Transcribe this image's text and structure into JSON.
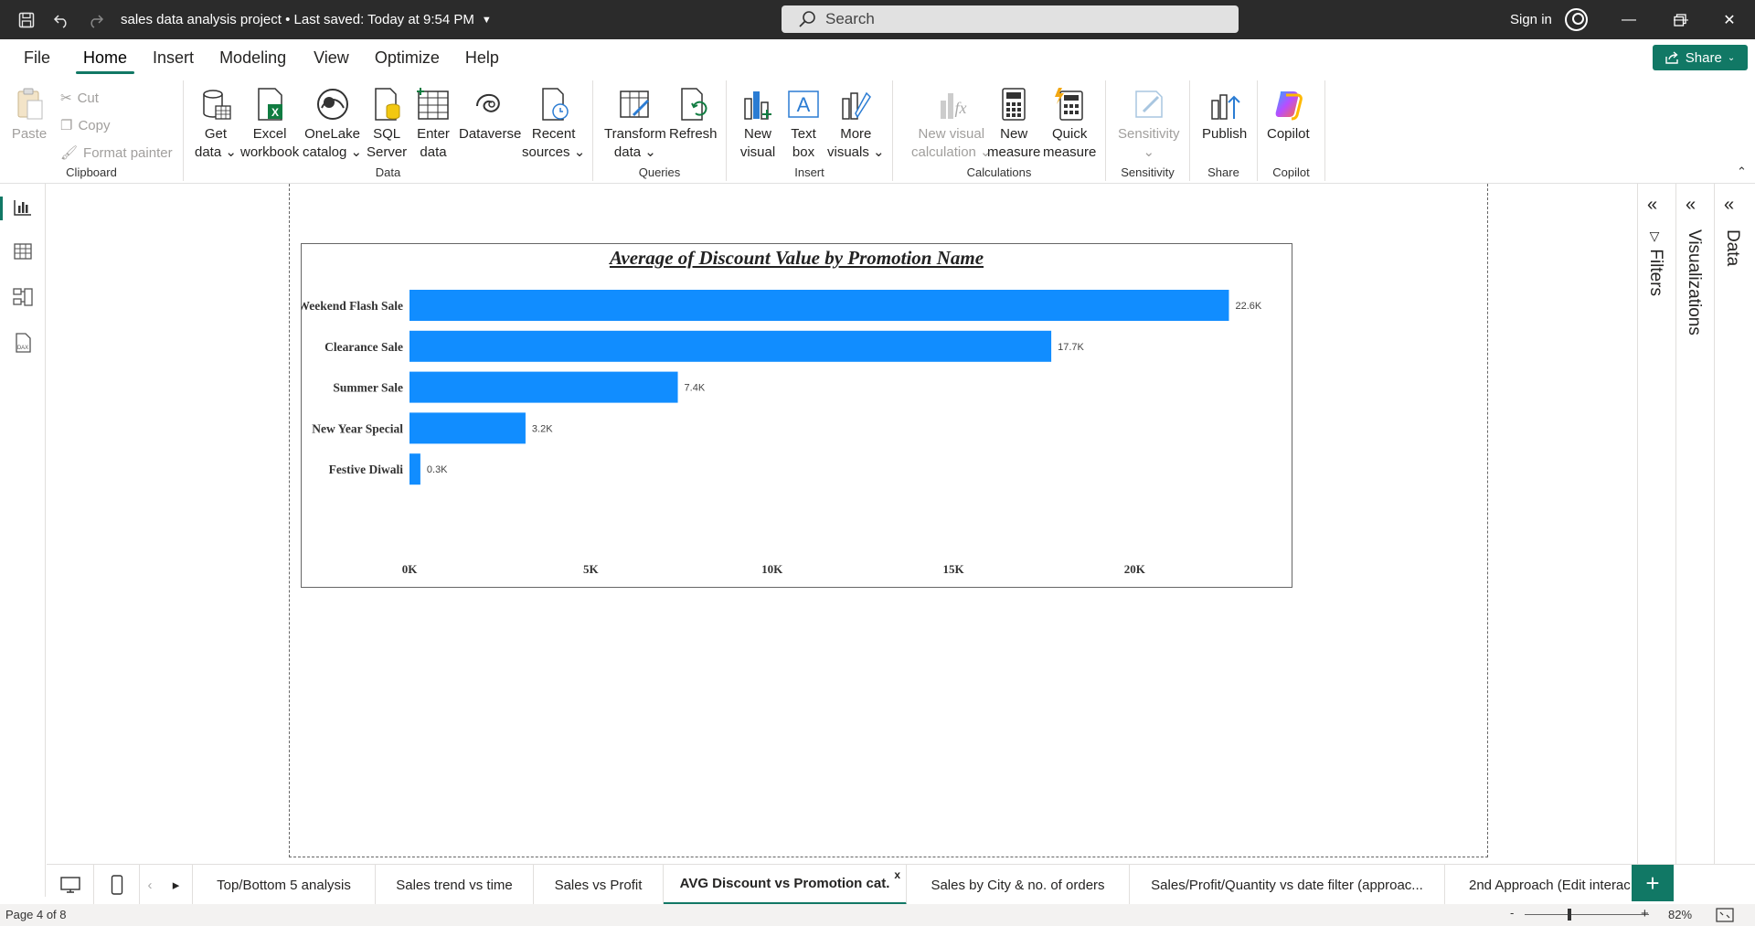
{
  "titlebar": {
    "title": "sales data analysis project",
    "saved": "Last saved: Today at 9:54 PM",
    "search_placeholder": "Search",
    "signin": "Sign in"
  },
  "menu": {
    "tabs": [
      "File",
      "Home",
      "Insert",
      "Modeling",
      "View",
      "Optimize",
      "Help"
    ],
    "active": "Home",
    "share": "Share"
  },
  "ribbon": {
    "clipboard": {
      "paste": "Paste",
      "cut": "Cut",
      "copy": "Copy",
      "format_painter": "Format painter",
      "label": "Clipboard"
    },
    "data": {
      "get_data": [
        "Get",
        "data"
      ],
      "excel": [
        "Excel",
        "workbook"
      ],
      "onelake": [
        "OneLake",
        "catalog"
      ],
      "sql": [
        "SQL",
        "Server"
      ],
      "enter": [
        "Enter",
        "data"
      ],
      "dataverse": [
        "Dataverse",
        ""
      ],
      "recent": [
        "Recent",
        "sources"
      ],
      "label": "Data"
    },
    "queries": {
      "transform": [
        "Transform",
        "data"
      ],
      "refresh": [
        "Refresh",
        ""
      ],
      "label": "Queries"
    },
    "insert": {
      "new_visual": [
        "New",
        "visual"
      ],
      "text_box": [
        "Text",
        "box"
      ],
      "more_visuals": [
        "More",
        "visuals"
      ],
      "label": "Insert"
    },
    "calculations": {
      "new_visual_calc": [
        "New visual",
        "calculation"
      ],
      "new_measure": [
        "New",
        "measure"
      ],
      "quick_measure": [
        "Quick",
        "measure"
      ],
      "label": "Calculations"
    },
    "sensitivity": {
      "btn": "Sensitivity",
      "label": "Sensitivity"
    },
    "share": {
      "publish": "Publish",
      "label": "Share"
    },
    "copilot": {
      "btn": "Copilot",
      "label": "Copilot"
    }
  },
  "panes": {
    "filters": "Filters",
    "visualizations": "Visualizations",
    "data": "Data"
  },
  "chart_data": {
    "type": "bar",
    "orientation": "horizontal",
    "title": "Average of Discount Value by Promotion Name",
    "categories": [
      "Weekend Flash Sale",
      "Clearance Sale",
      "Summer Sale",
      "New Year Special",
      "Festive Diwali"
    ],
    "values": [
      22600,
      17700,
      7400,
      3200,
      300
    ],
    "data_labels": [
      "22.6K",
      "17.7K",
      "7.4K",
      "3.2K",
      "0.3K"
    ],
    "x_ticks": [
      "0K",
      "5K",
      "10K",
      "15K",
      "20K"
    ],
    "x_tick_values": [
      0,
      5000,
      10000,
      15000,
      20000
    ],
    "xlim": [
      0,
      24000
    ],
    "bar_color": "#118DFF",
    "grid": false
  },
  "page_tabs": {
    "tabs": [
      "Top/Bottom 5 analysis",
      "Sales trend vs time",
      "Sales vs Profit",
      "AVG Discount vs Promotion cat.",
      "Sales by City & no. of orders",
      "Sales/Profit/Quantity vs date filter (approac...",
      "2nd Approach (Edit interac"
    ],
    "active_index": 3,
    "close": "x"
  },
  "status": {
    "page": "Page 4 of 8",
    "zoom": "82%",
    "minus": "-",
    "plus": "+"
  },
  "colors": {
    "accent": "#117865",
    "titlebar": "#2b2b2b"
  }
}
